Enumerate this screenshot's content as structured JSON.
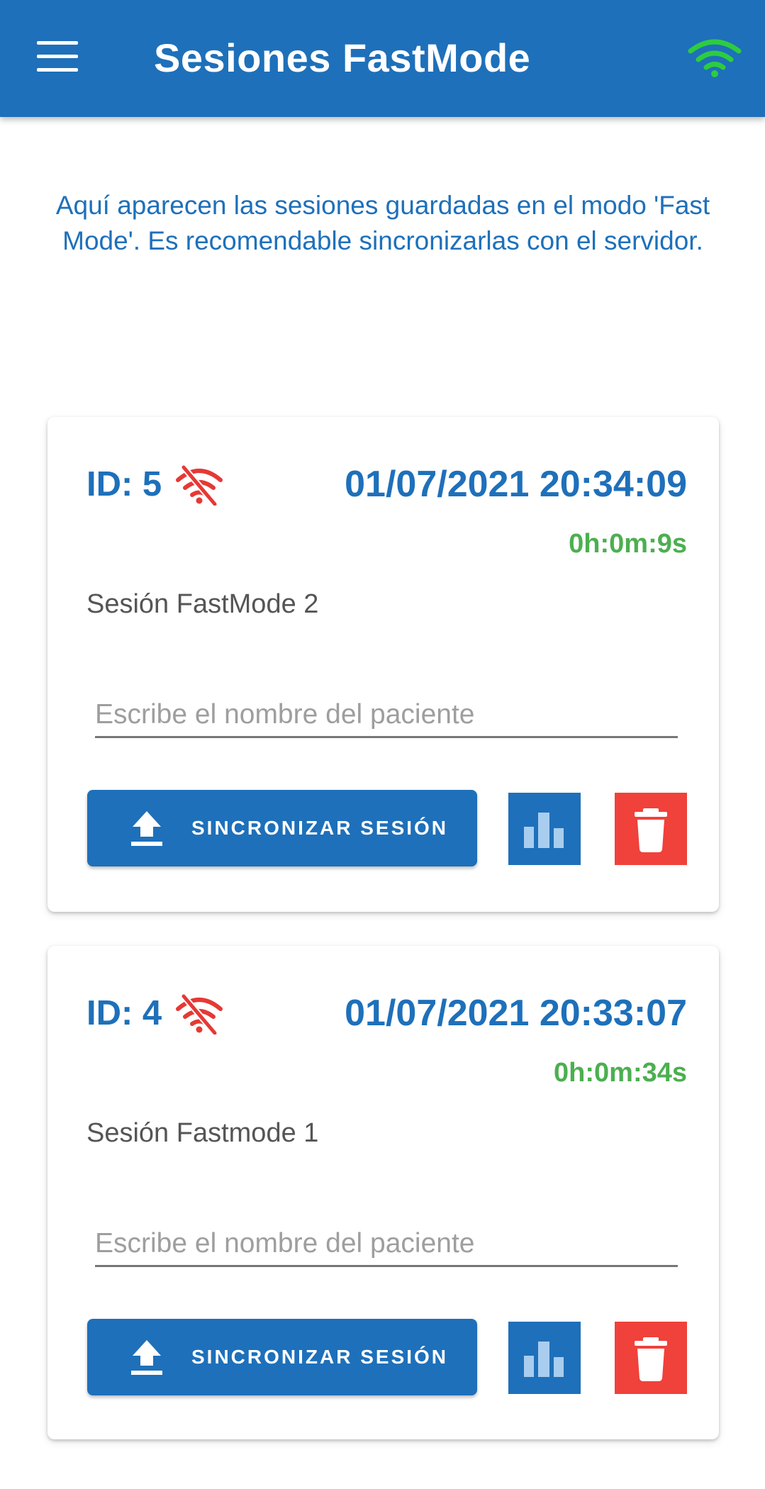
{
  "appbar": {
    "title": "Sesiones FastMode",
    "menu_icon": "menu-icon",
    "status_icon": "wifi-icon",
    "status_color": "#2ecc40",
    "background": "#1e70ba"
  },
  "intro": {
    "text": "Aquí aparecen las sesiones guardadas en el modo 'Fast Mode'. Es recomendable sincronizarlas con el servidor."
  },
  "sessions": [
    {
      "id_label": "ID: 5",
      "sync_status_icon": "wifi-off-icon",
      "datetime": "01/07/2021 20:34:09",
      "duration": "0h:0m:9s",
      "name": "Sesión FastMode 2",
      "patient_placeholder": "Escribe el nombre del paciente",
      "patient_value": "",
      "sync_button_label": "SINCRONIZAR SESIÓN"
    },
    {
      "id_label": "ID: 4",
      "sync_status_icon": "wifi-off-icon",
      "datetime": "01/07/2021 20:33:07",
      "duration": "0h:0m:34s",
      "name": "Sesión Fastmode 1",
      "patient_placeholder": "Escribe el nombre del paciente",
      "patient_value": "",
      "sync_button_label": "SINCRONIZAR SESIÓN"
    }
  ],
  "colors": {
    "primary": "#1e70ba",
    "duration_green": "#4caf50",
    "delete_red": "#f0413a",
    "offline_red": "#e53935"
  }
}
